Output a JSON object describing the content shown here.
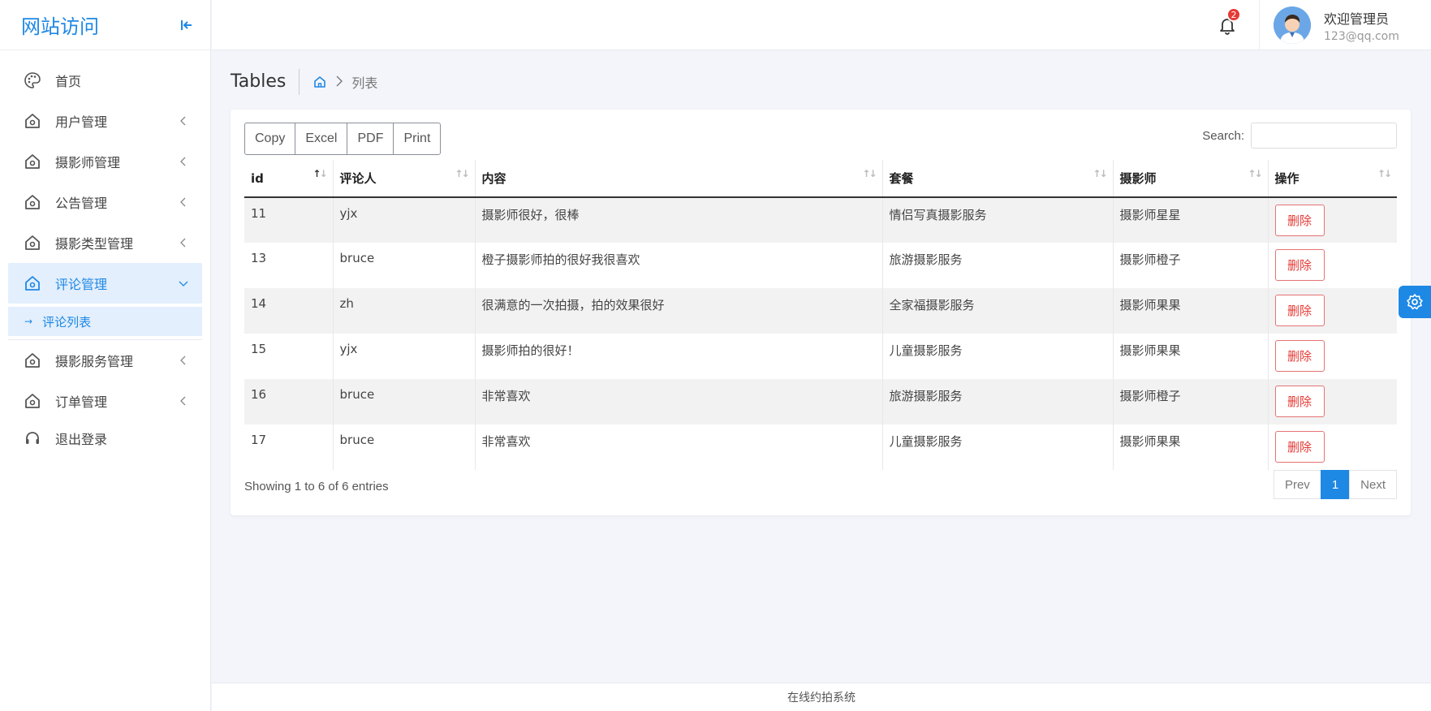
{
  "brand": {
    "title": "网站访问"
  },
  "sidebar": {
    "items": [
      {
        "label": "首页",
        "icon": "palette-icon",
        "has_arrow": false
      },
      {
        "label": "用户管理",
        "icon": "home-icon",
        "has_arrow": true
      },
      {
        "label": "摄影师管理",
        "icon": "home-icon",
        "has_arrow": true
      },
      {
        "label": "公告管理",
        "icon": "home-icon",
        "has_arrow": true
      },
      {
        "label": "摄影类型管理",
        "icon": "home-icon",
        "has_arrow": true
      },
      {
        "label": "评论管理",
        "icon": "home-icon",
        "has_arrow": true,
        "active": true
      },
      {
        "label": "摄影服务管理",
        "icon": "home-icon",
        "has_arrow": true
      },
      {
        "label": "订单管理",
        "icon": "home-icon",
        "has_arrow": true
      },
      {
        "label": "退出登录",
        "icon": "headset-icon",
        "has_arrow": false
      }
    ],
    "submenu": {
      "label": "评论列表"
    }
  },
  "header": {
    "notification_count": "2",
    "user_name": "欢迎管理员",
    "user_email": "123@qq.com"
  },
  "page": {
    "title": "Tables",
    "breadcrumb_current": "列表"
  },
  "toolbar": {
    "copy": "Copy",
    "excel": "Excel",
    "pdf": "PDF",
    "print": "Print"
  },
  "search": {
    "label": "Search:",
    "value": "",
    "placeholder": ""
  },
  "table": {
    "columns": [
      "id",
      "评论人",
      "内容",
      "套餐",
      "摄影师",
      "操作"
    ],
    "rows": [
      {
        "id": "11",
        "user": "yjx",
        "content": "摄影师很好，很棒",
        "package": "情侣写真摄影服务",
        "photographer": "摄影师星星",
        "action": "删除"
      },
      {
        "id": "13",
        "user": "bruce",
        "content": "橙子摄影师拍的很好我很喜欢",
        "package": "旅游摄影服务",
        "photographer": "摄影师橙子",
        "action": "删除"
      },
      {
        "id": "14",
        "user": "zh",
        "content": "很满意的一次拍摄，拍的效果很好",
        "package": "全家福摄影服务",
        "photographer": "摄影师果果",
        "action": "删除"
      },
      {
        "id": "15",
        "user": "yjx",
        "content": "摄影师拍的很好！",
        "package": "儿童摄影服务",
        "photographer": "摄影师果果",
        "action": "删除"
      },
      {
        "id": "16",
        "user": "bruce",
        "content": "非常喜欢",
        "package": "旅游摄影服务",
        "photographer": "摄影师橙子",
        "action": "删除"
      },
      {
        "id": "17",
        "user": "bruce",
        "content": "非常喜欢",
        "package": "儿童摄影服务",
        "photographer": "摄影师果果",
        "action": "删除"
      }
    ]
  },
  "pagination": {
    "info": "Showing 1 to 6 of 6 entries",
    "prev": "Prev",
    "current": "1",
    "next": "Next"
  },
  "footer": {
    "text": "在线约拍系统"
  },
  "colors": {
    "accent": "#1e88e5",
    "danger": "#e53935"
  }
}
